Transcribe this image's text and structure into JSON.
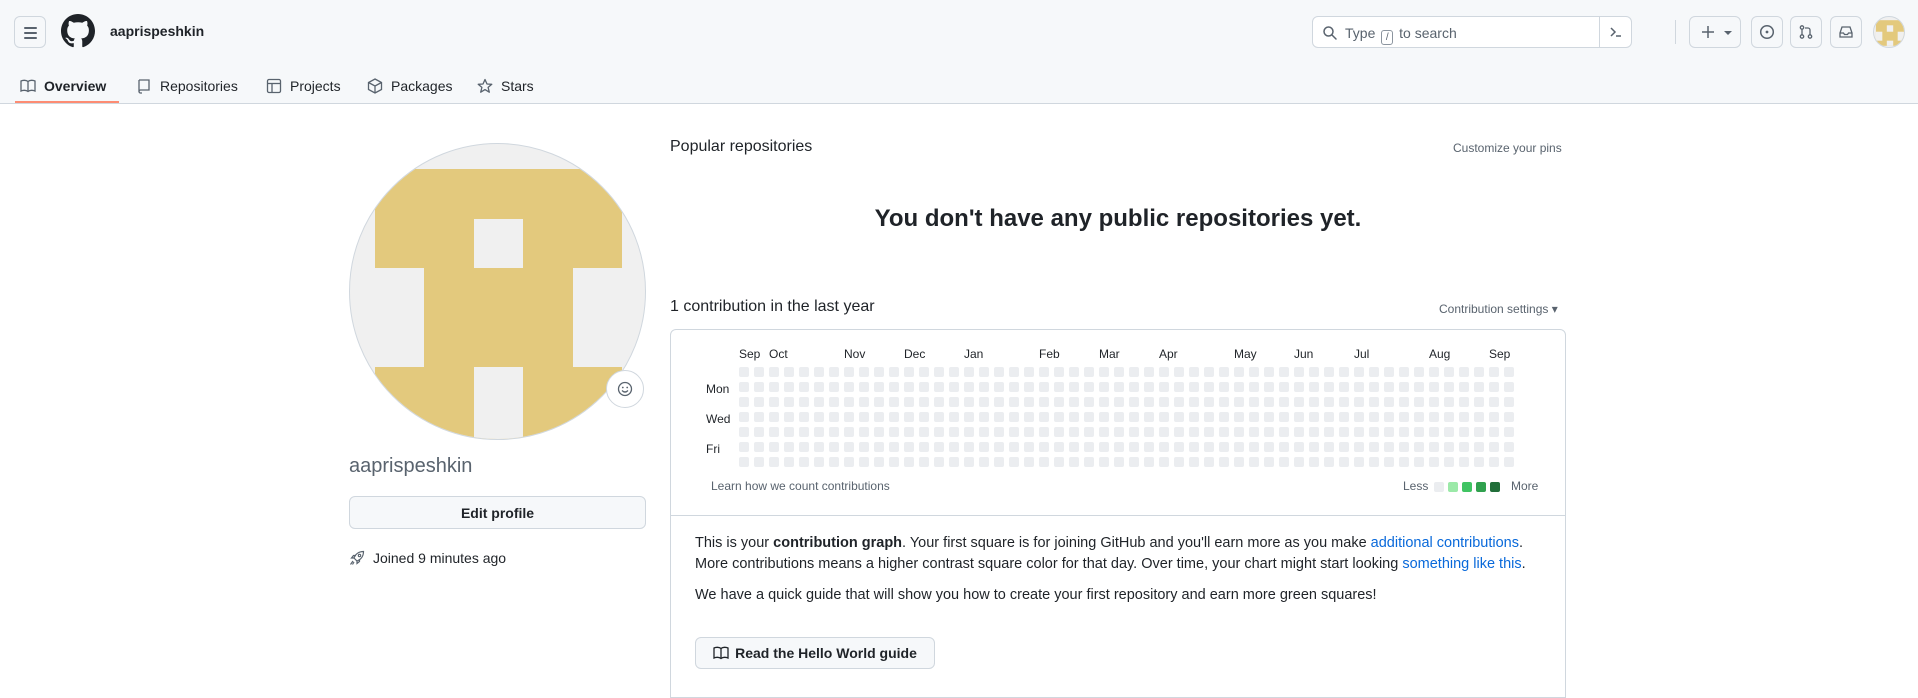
{
  "header": {
    "username": "aaprispeshkin",
    "search": {
      "prefix": "Type",
      "key": "/",
      "suffix": "to search"
    }
  },
  "tabs": [
    {
      "label": "Overview",
      "icon": "book-icon",
      "active": true
    },
    {
      "label": "Repositories",
      "icon": "repo-icon"
    },
    {
      "label": "Projects",
      "icon": "table-icon"
    },
    {
      "label": "Packages",
      "icon": "package-icon"
    },
    {
      "label": "Stars",
      "icon": "star-icon"
    }
  ],
  "profile": {
    "name": "aaprispeshkin",
    "edit_label": "Edit profile",
    "joined": "Joined 9 minutes ago",
    "avatar_color": "#e3c97d"
  },
  "popular": {
    "title": "Popular repositories",
    "customize": "Customize your pins",
    "empty": "You don't have any public repositories yet."
  },
  "contributions": {
    "title": "1 contribution in the last year",
    "settings": "Contribution settings ▾",
    "months": [
      "Sep",
      "Oct",
      "Nov",
      "Dec",
      "Jan",
      "Feb",
      "Mar",
      "Apr",
      "May",
      "Jun",
      "Jul",
      "Aug",
      "Sep"
    ],
    "day_labels": [
      "Mon",
      "Wed",
      "Fri"
    ],
    "learn": "Learn how we count contributions",
    "legend_less": "Less",
    "legend_more": "More",
    "legend_colors": [
      "#ebedf0",
      "#9be9a8",
      "#40c463",
      "#30a14e",
      "#216e39"
    ],
    "weeks": 53,
    "active_cell": {
      "week": 52,
      "day": 3,
      "color": "#216e39"
    }
  },
  "info": {
    "p1_a": "This is your ",
    "p1_bold": "contribution graph",
    "p1_b": ". Your first square is for joining GitHub and you'll earn more as you make ",
    "p1_link1": "additional contributions",
    "p1_c": ". More contributions means a higher contrast square color for that day. Over time, your chart might start looking ",
    "p1_link2": "something like this",
    "p1_d": ".",
    "p2": "We have a quick guide that will show you how to create your first repository and earn more green squares!",
    "button": "Read the Hello World guide"
  }
}
